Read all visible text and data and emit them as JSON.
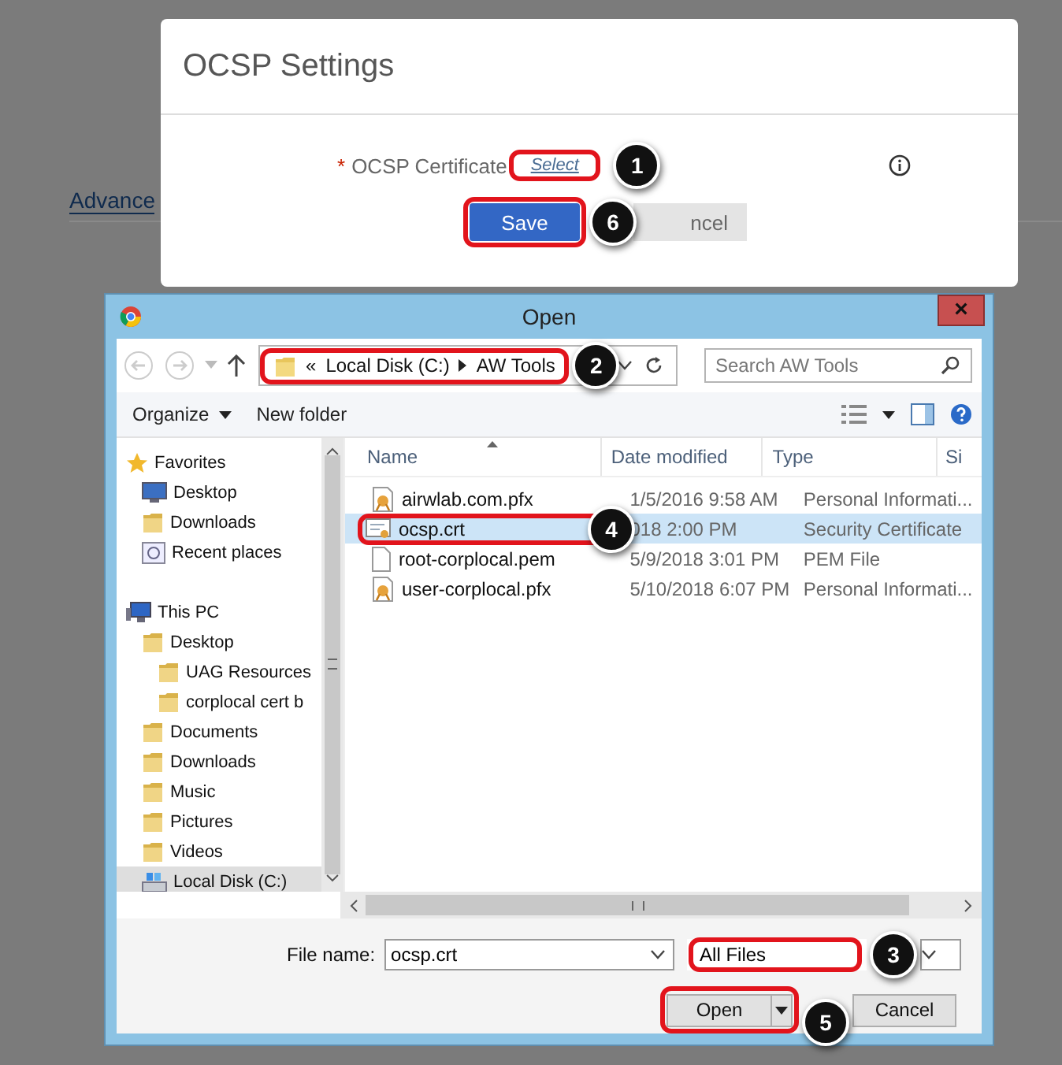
{
  "page": {
    "section_heading": "Advance"
  },
  "ocsp_modal": {
    "title": "OCSP Settings",
    "field": {
      "required_mark": "*",
      "label": "OCSP Certificate",
      "link": "Select",
      "highlighted": true,
      "callout": "1"
    },
    "buttons": [
      {
        "kind": "primary",
        "label": "Save",
        "highlighted": true,
        "callout": "6"
      },
      {
        "kind": "secondary",
        "label": "ncel",
        "highlighted": false
      }
    ]
  },
  "open_dialog": {
    "title": "Open",
    "close": "×",
    "breadcrumb": {
      "overflow": "«",
      "parts": [
        "Local Disk (C:)",
        "AW Tools"
      ],
      "highlighted": true,
      "callout": "2"
    },
    "search": {
      "placeholder": "Search AW Tools"
    },
    "toolbar": {
      "organize": "Organize",
      "new_folder": "New folder"
    },
    "nav_tree": [
      {
        "label": "Favorites",
        "kind": "star",
        "selected": false,
        "children": [
          {
            "label": "Desktop",
            "kind": "monitor",
            "selected": false
          },
          {
            "label": "Downloads",
            "kind": "folder",
            "selected": false
          },
          {
            "label": "Recent places",
            "kind": "recent",
            "selected": false
          }
        ]
      },
      {
        "label": "This PC",
        "kind": "pc",
        "selected": false,
        "children": [
          {
            "label": "Desktop",
            "kind": "folder",
            "selected": false,
            "children": [
              {
                "label": "UAG Resources",
                "kind": "folder",
                "selected": false
              },
              {
                "label": "corplocal cert b",
                "kind": "folder",
                "selected": false
              }
            ]
          },
          {
            "label": "Documents",
            "kind": "folder",
            "selected": false
          },
          {
            "label": "Downloads",
            "kind": "folder",
            "selected": false
          },
          {
            "label": "Music",
            "kind": "folder",
            "selected": false
          },
          {
            "label": "Pictures",
            "kind": "folder",
            "selected": false
          },
          {
            "label": "Videos",
            "kind": "folder",
            "selected": false
          },
          {
            "label": "Local Disk (C:)",
            "kind": "drive",
            "selected": true
          }
        ]
      }
    ],
    "columns": [
      "Name",
      "Date modified",
      "Type",
      "Si"
    ],
    "files": [
      {
        "name": "airwlab.com.pfx",
        "date": "1/5/2016 9:58 AM",
        "type": "Personal Informati...",
        "kind": "cert",
        "selected": false,
        "highlighted": false
      },
      {
        "name": "ocsp.crt",
        "date": "018 2:00 PM",
        "type": "Security Certificate",
        "kind": "crt",
        "selected": true,
        "highlighted": true,
        "callout": "4"
      },
      {
        "name": "root-corplocal.pem",
        "date": "5/9/2018 3:01 PM",
        "type": "PEM File",
        "kind": "file",
        "selected": false,
        "highlighted": false
      },
      {
        "name": "user-corplocal.pfx",
        "date": "5/10/2018 6:07 PM",
        "type": "Personal Informati...",
        "kind": "cert",
        "selected": false,
        "highlighted": false
      }
    ],
    "file_name": {
      "label": "File name:",
      "value": "ocsp.crt"
    },
    "filter": {
      "value": "All Files",
      "highlighted": true,
      "callout": "3"
    },
    "buttons": [
      {
        "kind": "split",
        "label": "Open",
        "highlighted": true,
        "callout": "5"
      },
      {
        "kind": "plain",
        "label": "Cancel",
        "highlighted": false
      }
    ]
  }
}
